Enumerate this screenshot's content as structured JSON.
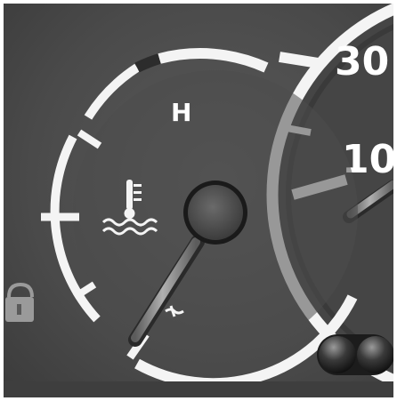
{
  "temperature_gauge": {
    "hot_label": "H",
    "needle_level_fraction": 0.12,
    "icon": "coolant-temperature-icon"
  },
  "speedometer": {
    "labels": [
      "30",
      "10"
    ]
  },
  "lock_indicator": {
    "icon": "padlock-icon"
  },
  "control_knob": {
    "icon": "rocker-switch"
  },
  "colors": {
    "panel": "#4a4a4a",
    "markings": "#f4f4f4",
    "needle": "#8c8c8c",
    "background": "#ffffff"
  }
}
